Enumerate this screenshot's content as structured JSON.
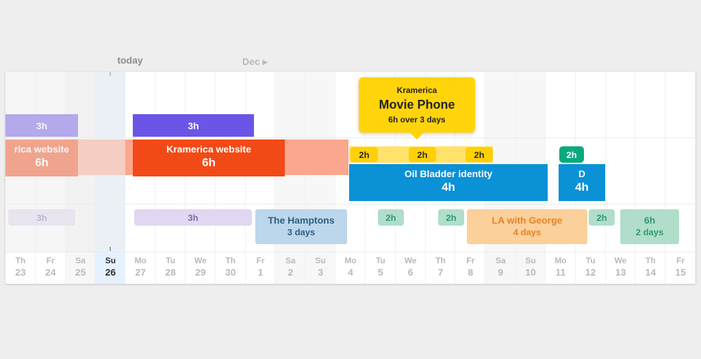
{
  "header": {
    "today_label": "today",
    "month_label": "Dec"
  },
  "tooltip": {
    "context": "Kramerica",
    "title": "Movie Phone",
    "subtitle": "6h over 3 days"
  },
  "rows": {
    "row1": {
      "left_hours": "3h",
      "right_hours": "3h"
    },
    "row2": {
      "yellow_h1": "2h",
      "yellow_h2": "2h",
      "yellow_h3": "2h",
      "green_h": "2h",
      "left": {
        "title": "rica website",
        "hours": "6h"
      },
      "mid": {
        "title": "Kramerica website",
        "hours": "6h"
      },
      "blue": {
        "title": "Oil Bladder identity",
        "hours": "4h"
      },
      "blue2": {
        "title": "D",
        "hours": "4h"
      }
    },
    "row3": {
      "p1": "3h",
      "p2": "3h",
      "g1": "2h",
      "g2": "2h",
      "g3": "2h",
      "trip1": {
        "title": "The Hamptons",
        "sub": "3 days"
      },
      "trip2": {
        "title": "LA with George",
        "sub": "4 days"
      },
      "trip3": {
        "title": "6h",
        "sub": "2 days"
      }
    }
  },
  "axis": [
    {
      "dow": "Th",
      "num": "23"
    },
    {
      "dow": "Fr",
      "num": "24"
    },
    {
      "dow": "Sa",
      "num": "25"
    },
    {
      "dow": "Su",
      "num": "26",
      "today": true
    },
    {
      "dow": "Mo",
      "num": "27"
    },
    {
      "dow": "Tu",
      "num": "28"
    },
    {
      "dow": "We",
      "num": "29"
    },
    {
      "dow": "Th",
      "num": "30"
    },
    {
      "dow": "Fr",
      "num": "1"
    },
    {
      "dow": "Sa",
      "num": "2"
    },
    {
      "dow": "Su",
      "num": "3"
    },
    {
      "dow": "Mo",
      "num": "4"
    },
    {
      "dow": "Tu",
      "num": "5"
    },
    {
      "dow": "We",
      "num": "6"
    },
    {
      "dow": "Th",
      "num": "7"
    },
    {
      "dow": "Fr",
      "num": "8"
    },
    {
      "dow": "Sa",
      "num": "9"
    },
    {
      "dow": "Su",
      "num": "10"
    },
    {
      "dow": "Mo",
      "num": "11"
    },
    {
      "dow": "Tu",
      "num": "12"
    },
    {
      "dow": "We",
      "num": "13"
    },
    {
      "dow": "Th",
      "num": "14"
    },
    {
      "dow": "Fr",
      "num": "15"
    }
  ],
  "layout": {
    "col_width": 43.83,
    "today_index": 3,
    "weekend_indices": [
      2,
      3,
      9,
      10,
      16,
      17
    ]
  },
  "colors": {
    "purple": "#6b55e6",
    "orange": "#f24a17",
    "blue": "#0a91d6",
    "green": "#0aa97f",
    "yellow": "#ffd006"
  }
}
